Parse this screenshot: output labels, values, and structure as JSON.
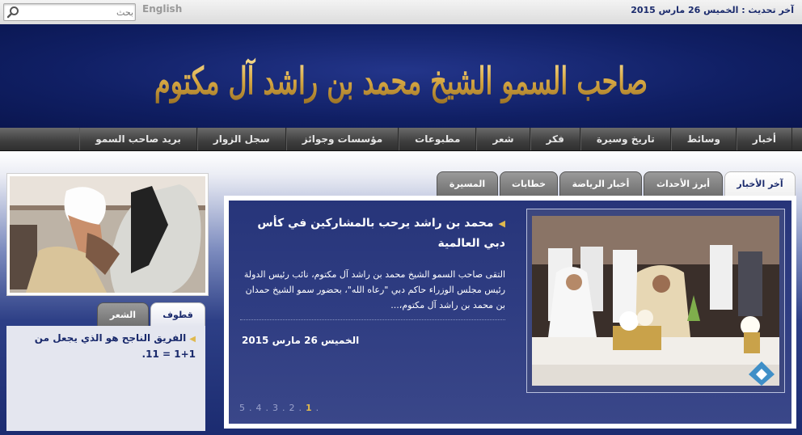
{
  "topbar": {
    "search_placeholder": "بحث",
    "language_link": "English",
    "last_updated_label": "آخر تحديث :",
    "last_updated_date": "الخميس 26 مارس 2015"
  },
  "header": {
    "calligraphy_title": "صاحب السمو الشيخ محمد بن راشد آل مكتوم"
  },
  "nav": {
    "items": [
      {
        "label": "أخبار"
      },
      {
        "label": "وسائط"
      },
      {
        "label": "تاريخ وسيرة"
      },
      {
        "label": "فكر"
      },
      {
        "label": "شعر"
      },
      {
        "label": "مطبوعات"
      },
      {
        "label": "مؤسسات وجوائز"
      },
      {
        "label": "سجل الزوار"
      },
      {
        "label": "بريد صاحب السمو"
      }
    ]
  },
  "news_tabs": [
    {
      "label": "آخر الأخبار",
      "active": true
    },
    {
      "label": "أبرز الأحداث",
      "active": false
    },
    {
      "label": "أخبار الرياضة",
      "active": false
    },
    {
      "label": "خطابات",
      "active": false
    },
    {
      "label": "المسيرة",
      "active": false
    }
  ],
  "featured_news": {
    "title": "محمد بن راشد يرحب بالمشاركين في كأس دبي العالمية",
    "summary": "التقى صاحب السمو الشيخ محمد بن راشد آل مكتوم، نائب رئيس الدولة رئيس مجلس الوزراء حاكم دبي \"رعاه الله\"، بحضور سمو الشيخ حمدان بن محمد بن راشد آل مكتوم،...",
    "date": "الخميس 26 مارس 2015",
    "pager": [
      "1",
      "2",
      "3",
      "4",
      "5"
    ],
    "pager_active": "1"
  },
  "side_tabs": [
    {
      "label": "قطوف",
      "active": true
    },
    {
      "label": "الشعر",
      "active": false
    }
  ],
  "side_panel": {
    "items": [
      {
        "text": "الفريق الناجح هو الذي يجعل من 1+1 = 11."
      }
    ]
  },
  "colors": {
    "brand_navy": "#1a2a6c",
    "gold": "#e0b94d",
    "nav_bar": "#3e3e3e"
  }
}
